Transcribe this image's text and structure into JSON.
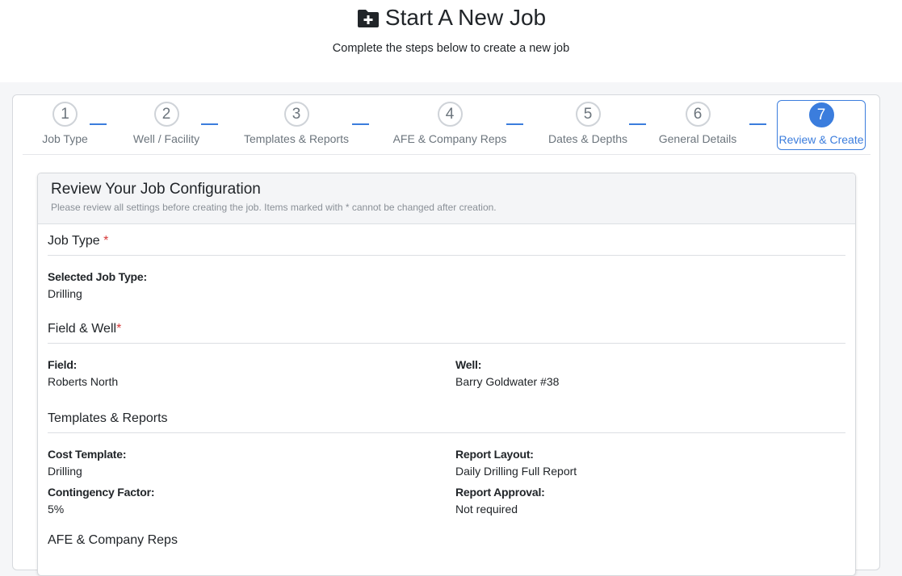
{
  "page": {
    "title": "Start A New Job",
    "title_icon": "folder-plus-icon",
    "subtitle": "Complete the steps below to create a new job"
  },
  "stepper": {
    "steps": [
      {
        "number": "1",
        "label": "Job Type"
      },
      {
        "number": "2",
        "label": "Well / Facility"
      },
      {
        "number": "3",
        "label": "Templates & Reports"
      },
      {
        "number": "4",
        "label": "AFE & Company Reps"
      },
      {
        "number": "5",
        "label": "Dates & Depths"
      },
      {
        "number": "6",
        "label": "General Details"
      },
      {
        "number": "7",
        "label": "Review & Create"
      }
    ],
    "active_step": 7,
    "accent_color": "#3b7ddd"
  },
  "review": {
    "title": "Review Your Job Configuration",
    "subtitle": "Please review all settings before creating the job. Items marked with * cannot be changed after creation.",
    "sections": {
      "job_type": {
        "title": "Job Type",
        "required_mark": "*",
        "fields": {
          "selected_job_type": {
            "label": "Selected Job Type:",
            "value": "Drilling"
          }
        }
      },
      "field_well": {
        "title": "Field & Well",
        "required_mark": "*",
        "fields": {
          "field": {
            "label": "Field:",
            "value": "Roberts North"
          },
          "well": {
            "label": "Well:",
            "value": "Barry Goldwater #38"
          }
        }
      },
      "templates_reports": {
        "title": "Templates & Reports",
        "fields": {
          "cost_template": {
            "label": "Cost Template:",
            "value": "Drilling"
          },
          "report_layout": {
            "label": "Report Layout:",
            "value": "Daily Drilling Full Report"
          },
          "contingency_factor": {
            "label": "Contingency Factor:",
            "value": "5%"
          },
          "report_approval": {
            "label": "Report Approval:",
            "value": "Not required"
          }
        }
      },
      "afe_company_reps": {
        "title": "AFE & Company Reps"
      }
    }
  }
}
